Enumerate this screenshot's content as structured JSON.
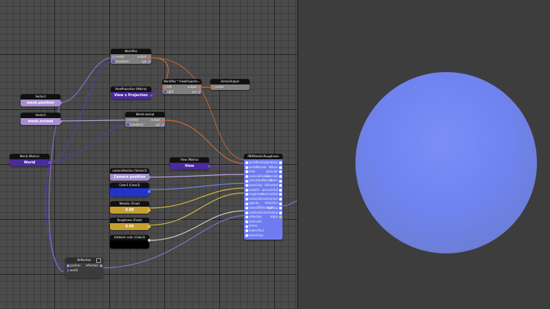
{
  "nodes": {
    "worldpos": {
      "title": "WorldPos",
      "inputs": [
        "vector",
        "transform"
      ],
      "outputs": [
        "output",
        "xyz"
      ]
    },
    "worldpos_viewproj": {
      "title": "WorldPos * ViewProjectio...",
      "inputs": [
        "left",
        "right"
      ],
      "outputs": [
        "output",
        "xyz"
      ]
    },
    "vertexoutput": {
      "title": "VertexOutput",
      "inputs": [
        "vector"
      ]
    },
    "viewprojection": {
      "title": "ViewProjection (Matrix)",
      "value": "View x Projection"
    },
    "vector3_position": {
      "title": "Vector3",
      "value": "mesh.position"
    },
    "vector3_normal": {
      "title": "Vector3",
      "value": "mesh.normal"
    },
    "world_normal": {
      "title": "World normal",
      "inputs": [
        "vector",
        "transform"
      ],
      "outputs": [
        "output",
        "xyz"
      ]
    },
    "world_matrix": {
      "title": "World (Matrix)",
      "value": "World"
    },
    "view_matrix": {
      "title": "View (Matrix)",
      "value": "View"
    },
    "camera_position": {
      "title": "cameraPosition (Vector3)",
      "value": "Camera position"
    },
    "color3": {
      "title": "Color3 (Color3)"
    },
    "metallic": {
      "title": "Metallic (Float)",
      "value": "0.00"
    },
    "roughness": {
      "title": "Roughness (Float)",
      "value": "0.00"
    },
    "ambient_color": {
      "title": "Ambient color (Color3)"
    },
    "reflection": {
      "title": "Reflection",
      "inputs": [
        "position",
        "world"
      ],
      "outputs": [
        "reflection"
      ]
    },
    "pbr": {
      "title": "PBRMetallicRoughness",
      "rows": [
        [
          "worldPosition",
          "ambient"
        ],
        [
          "worldNormal",
          "diffuse"
        ],
        [
          "view",
          "specular"
        ],
        [
          "cameraPosition",
          "clearcoat"
        ],
        [
          "perturbedNormal",
          "sheen"
        ],
        [
          "baseColor",
          "diffuseInd"
        ],
        [
          "metallic",
          "specularInd"
        ],
        [
          "roughness",
          "clearcoatInd"
        ],
        [
          "ambientOcc",
          "sheenInd"
        ],
        [
          "opacity",
          "refraction"
        ],
        [
          "indexOfRefraction",
          "lighting"
        ],
        [
          "ambientColor",
          "shadow"
        ],
        [
          "reflection",
          "alpha"
        ],
        [
          "clearcoat",
          ""
        ],
        [
          "sheen",
          ""
        ],
        [
          "subsurface",
          ""
        ],
        [
          "anisotropy",
          ""
        ]
      ]
    }
  },
  "colors": {
    "vector_port": "#a08ee0",
    "matrix_port": "#6a4fc0",
    "vector4_port": "#e07830",
    "float_port": "#e0c050",
    "vector3_node": "#a78fd0",
    "matrix_node": "#4a2a9c",
    "color3_node": "#2233cc",
    "float_node": "#c8a032",
    "pbr_node": "#6e7cf0",
    "sphere": "#6f84f0",
    "preview_bg": "#3d3d3d"
  }
}
